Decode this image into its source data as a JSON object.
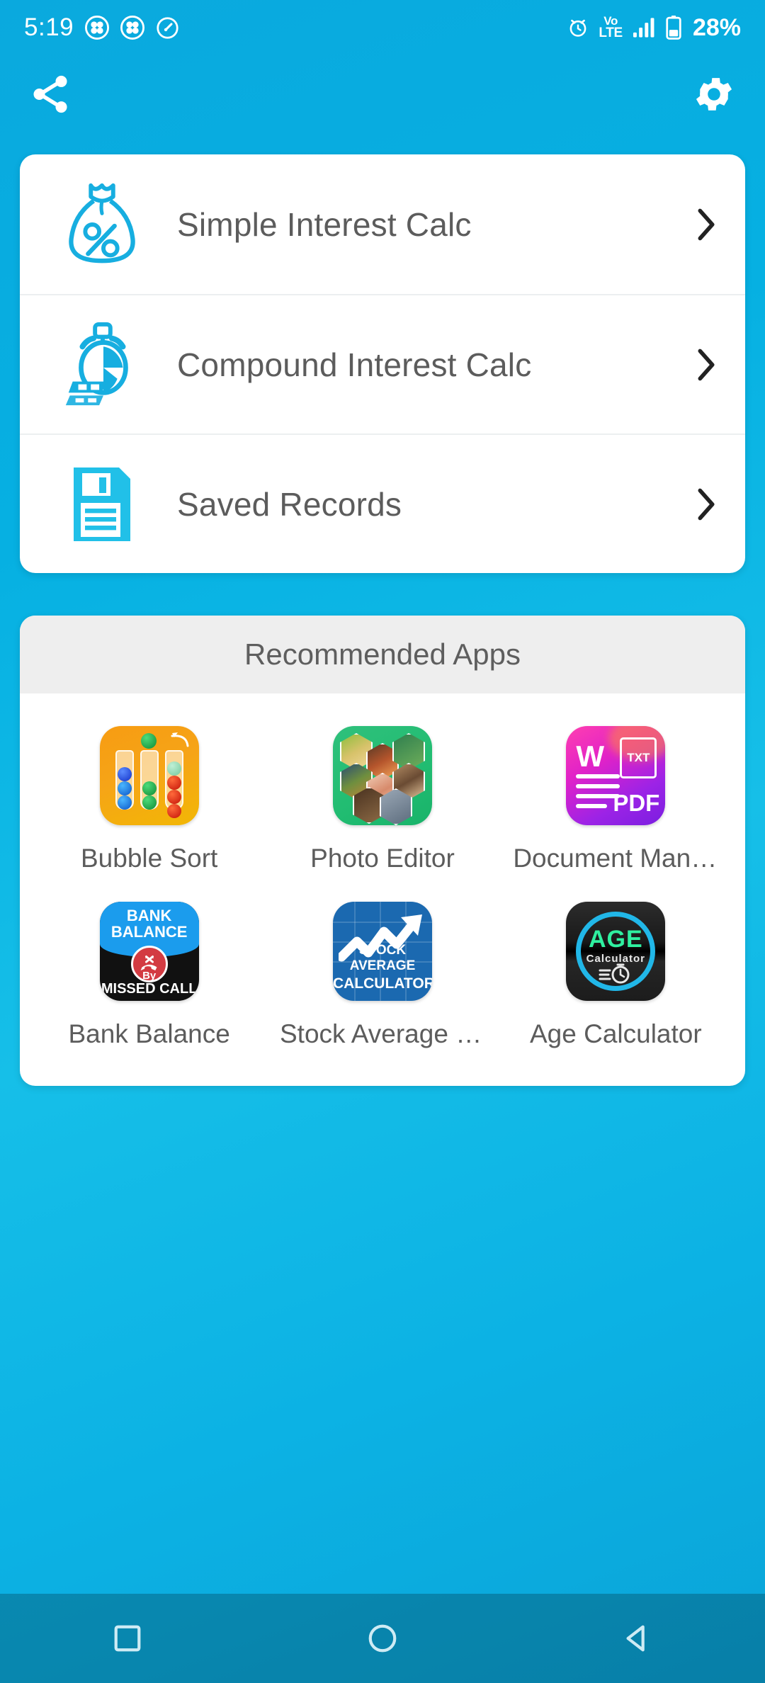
{
  "status_bar": {
    "time": "5:19",
    "battery_percent": "28%",
    "volte_top": "Vo",
    "volte_bottom": "LTE",
    "icons": [
      "app-cluster-icon",
      "app-cluster-icon",
      "speedometer-icon",
      "alarm-clock-icon",
      "volte-icon",
      "signal-bars-icon",
      "battery-icon"
    ]
  },
  "toolbar": {
    "share_icon": "share-icon",
    "settings_icon": "gear-icon"
  },
  "menu": {
    "items": [
      {
        "label": "Simple Interest Calc",
        "icon": "money-bag-percent-icon"
      },
      {
        "label": "Compound Interest Calc",
        "icon": "stopwatch-money-icon"
      },
      {
        "label": "Saved Records",
        "icon": "floppy-disk-icon"
      }
    ]
  },
  "recommended": {
    "header": "Recommended Apps",
    "apps": [
      {
        "label": "Bubble Sort",
        "icon": "bubble-sort-app-icon"
      },
      {
        "label": "Photo Editor",
        "icon": "photo-editor-app-icon"
      },
      {
        "label": "Document Mana…",
        "icon": "document-manager-app-icon"
      },
      {
        "label": "Bank Balance",
        "icon": "bank-balance-app-icon"
      },
      {
        "label": "Stock Average Calc",
        "icon": "stock-average-app-icon"
      },
      {
        "label": "Age Calculator",
        "icon": "age-calculator-app-icon"
      }
    ],
    "icon_text": {
      "doc_w": "W",
      "doc_txt": "TXT",
      "doc_pdf": "PDF",
      "bank_line1": "BANK",
      "bank_line2": "BALANCE",
      "bank_by": "By",
      "bank_missed": "MISSED CALL",
      "stock_line1": "STOCK AVERAGE",
      "stock_line2": "CALCULATOR",
      "age_line1": "AGE",
      "age_line2": "Calculator"
    }
  },
  "navbar": {
    "recents_icon": "square-icon",
    "home_icon": "circle-icon",
    "back_icon": "triangle-back-icon"
  },
  "colors": {
    "background_top": "#0aa9de",
    "background_bottom": "#0aa4d8",
    "accent": "#16b5e0",
    "card": "#ffffff",
    "text_primary": "#5c5c5c",
    "rec_header_bg": "#eeeeee"
  }
}
